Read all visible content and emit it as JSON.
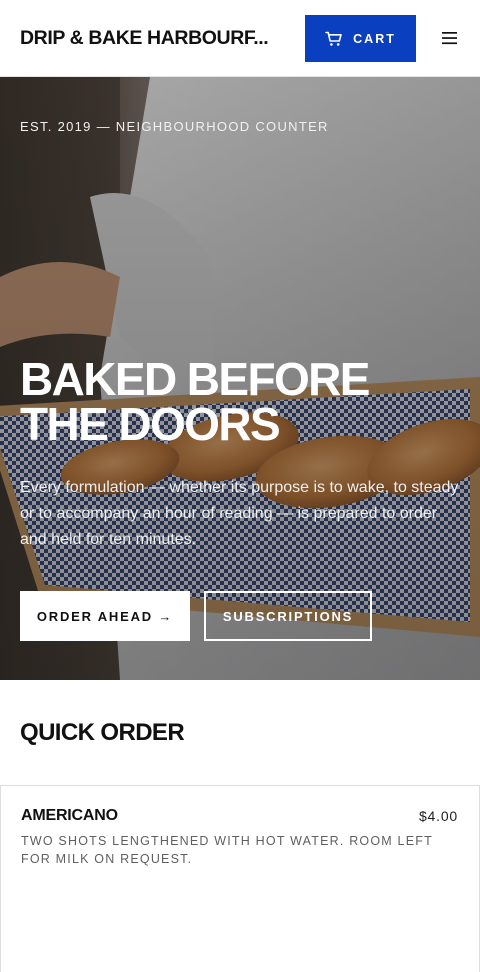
{
  "header": {
    "brand": "DRIP & BAKE HARBOURF...",
    "cart_label": "CART",
    "cart_icon": "shopping-cart-icon",
    "menu_icon": "hamburger-menu-icon"
  },
  "hero": {
    "eyebrow": "EST. 2019 — NEIGHBOURHOOD COUNTER",
    "title": "BAKED BEFORE THE DOORS",
    "body": "Every formulation — whether its purpose is to wake, to steady or to accompany an hour of reading — is prepared to order and held for ten minutes.",
    "primary_cta": "ORDER AHEAD →",
    "secondary_cta": "SUBSCRIPTIONS"
  },
  "quick_order": {
    "title": "QUICK ORDER",
    "items": [
      {
        "name": "AMERICANO",
        "price": "$4.00",
        "description": "TWO SHOTS LENGTHENED WITH HOT WATER. ROOM LEFT FOR MILK ON REQUEST."
      }
    ]
  },
  "colors": {
    "accent": "#0a3fbf",
    "text": "#111111",
    "muted": "#5f5f5f"
  }
}
